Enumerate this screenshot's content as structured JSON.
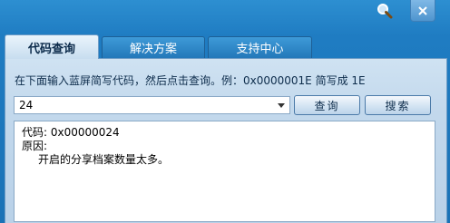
{
  "title_bar": {
    "search_icon": "magnifier-icon",
    "close_icon": "close-icon"
  },
  "tabs": [
    {
      "label": "代码查询",
      "active": true
    },
    {
      "label": "解决方案",
      "active": false
    },
    {
      "label": "支持中心",
      "active": false
    }
  ],
  "panel": {
    "instruction": "在下面输入蓝屏简写代码，然后点击查询。例：0x0000001E 简写成 1E",
    "code_input_value": "24",
    "query_button": "查询",
    "search_button": "搜索",
    "result": {
      "code_line": "代码: 0x00000024",
      "reason_label": "原因:",
      "reason_text": "开启的分享档案数量太多。"
    }
  },
  "colors": {
    "accent": "#1f7cc2",
    "panel_bg": "#c2d8ec"
  }
}
